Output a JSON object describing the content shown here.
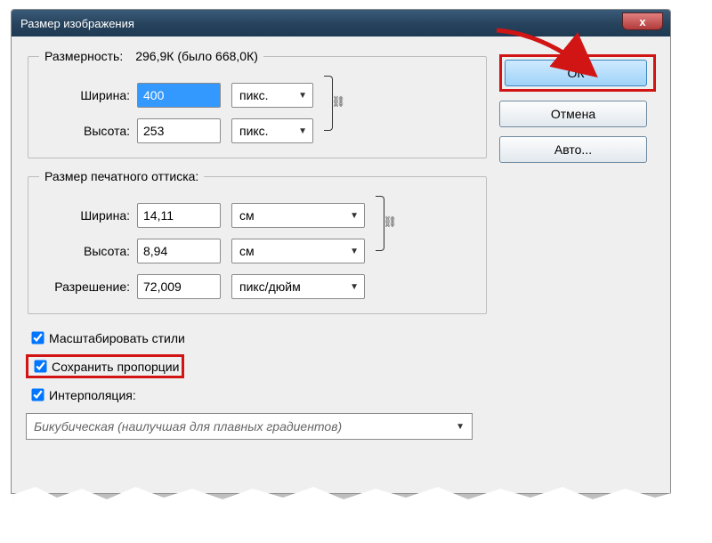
{
  "window": {
    "title": "Размер изображения",
    "close_glyph": "x"
  },
  "dimensions": {
    "legend_label": "Размерность:",
    "summary_value": "296,9К (было 668,0К)",
    "width_label": "Ширина:",
    "width_value": "400",
    "width_unit": "пикс.",
    "height_label": "Высота:",
    "height_value": "253",
    "height_unit": "пикс.",
    "link_glyph": "⛓"
  },
  "print_size": {
    "legend": "Размер печатного оттиска:",
    "width_label": "Ширина:",
    "width_value": "14,11",
    "width_unit": "см",
    "height_label": "Высота:",
    "height_value": "8,94",
    "height_unit": "см",
    "resolution_label": "Разрешение:",
    "resolution_value": "72,009",
    "resolution_unit": "пикс/дюйм",
    "link_glyph": "⛓"
  },
  "checks": {
    "scale_styles": "Масштабировать стили",
    "constrain_proportions": "Сохранить пропорции",
    "resample": "Интерполяция:"
  },
  "interpolation": {
    "selected": "Бикубическая (наилучшая для плавных градиентов)"
  },
  "buttons": {
    "ok": "ОК",
    "cancel": "Отмена",
    "auto": "Авто..."
  }
}
